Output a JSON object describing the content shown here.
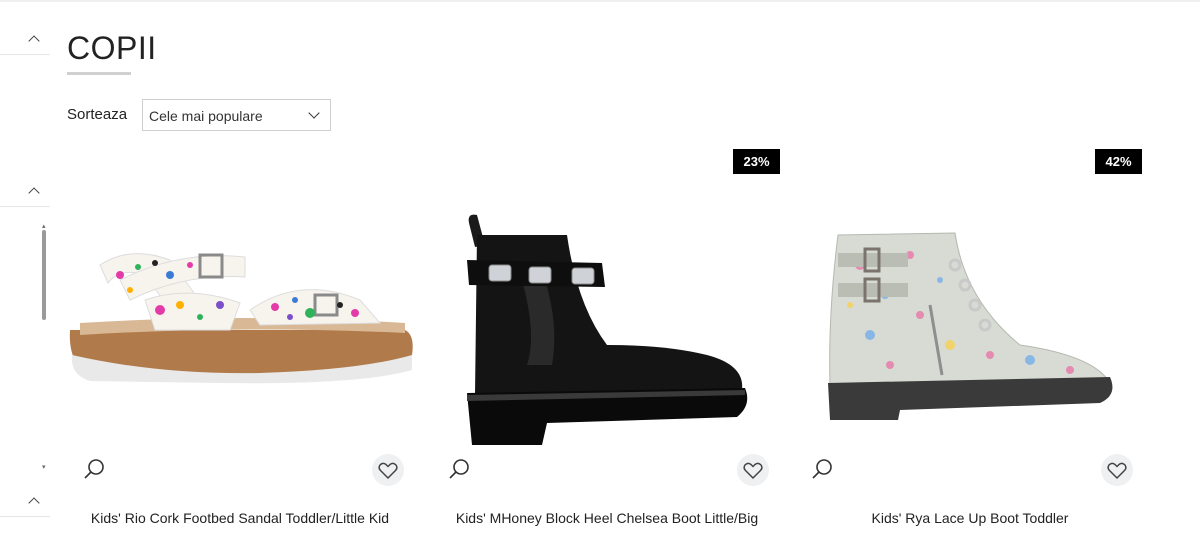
{
  "page": {
    "title": "COPII"
  },
  "sort": {
    "label": "Sorteaza",
    "selected": "Cele mai populare"
  },
  "icons": {
    "search": "search-icon",
    "wishlist": "heart-icon",
    "collapse": "chevron-up-icon",
    "dropdown": "chevron-down-icon"
  },
  "colors": {
    "badge_bg": "#000000",
    "badge_text": "#ffffff",
    "wishlist_bg": "#eef0f2"
  },
  "products": [
    {
      "name": "Kids' Rio Cork Footbed Sandal Toddler/Little Kid",
      "badge": ""
    },
    {
      "name": "Kids' MHoney Block Heel Chelsea Boot Little/Big",
      "badge": "23%"
    },
    {
      "name": "Kids' Rya Lace Up Boot Toddler",
      "badge": "42%"
    }
  ]
}
